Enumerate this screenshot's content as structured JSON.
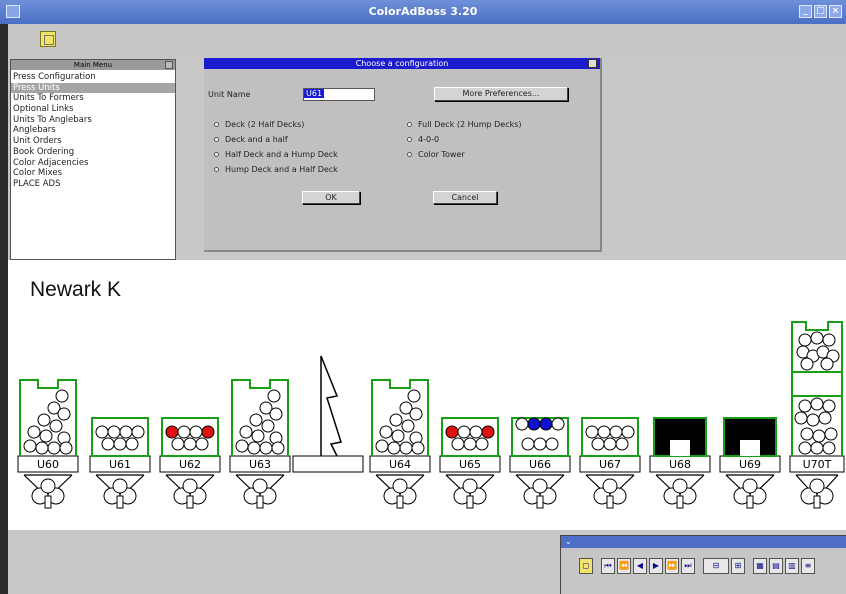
{
  "window": {
    "title": "ColorAdBoss 3.20"
  },
  "main_menu": {
    "title": "Main Menu",
    "items": [
      "Press Configuration",
      "Press Units",
      "Units To Formers",
      "Optional Links",
      "Units To Anglebars",
      "Anglebars",
      "Unit Orders",
      "Book Ordering",
      "Color Adjacencies",
      "Color Mixes",
      "PLACE ADS"
    ],
    "selected": "Press Units"
  },
  "dialog": {
    "title": "Choose a configuration",
    "unit_name_label": "Unit Name",
    "unit_name_value": "U61",
    "more_prefs": "More Preferences...",
    "options_left": [
      "Deck (2 Half Decks)",
      "Deck and a half",
      "Half Deck and a Hump Deck",
      "Hump Deck and a Half Deck"
    ],
    "options_right": [
      "Full Deck (2 Hump Decks)",
      "4-0-0",
      "Color Tower"
    ],
    "ok": "OK",
    "cancel": "Cancel"
  },
  "press": {
    "name": "Newark K",
    "units": [
      {
        "label": "U60",
        "type": "half-stack",
        "inks": "none"
      },
      {
        "label": "U61",
        "type": "deck",
        "inks": "none"
      },
      {
        "label": "U62",
        "type": "deck",
        "inks": "red"
      },
      {
        "label": "U63",
        "type": "half-stack",
        "inks": "none"
      },
      {
        "label": "",
        "type": "folder",
        "inks": "none"
      },
      {
        "label": "U64",
        "type": "half-stack",
        "inks": "none"
      },
      {
        "label": "U65",
        "type": "deck",
        "inks": "red"
      },
      {
        "label": "U66",
        "type": "deck-top",
        "inks": "blue"
      },
      {
        "label": "U67",
        "type": "deck",
        "inks": "none"
      },
      {
        "label": "U68",
        "type": "black",
        "inks": "none"
      },
      {
        "label": "U69",
        "type": "black",
        "inks": "none"
      },
      {
        "label": "U70T",
        "type": "tower",
        "inks": "none"
      }
    ],
    "colors": {
      "frame": "#16a016",
      "red": "#e01010",
      "blue": "#1010d0",
      "black": "#000000"
    }
  },
  "nav": {
    "buttons": [
      "camera-icon",
      "first-icon",
      "prev-page-icon",
      "prev-icon",
      "next-icon",
      "next-page-icon",
      "last-icon",
      "zoom-icon",
      "fit-icon",
      "grid-icon",
      "layout-icon",
      "split-icon",
      "more-icon"
    ]
  }
}
